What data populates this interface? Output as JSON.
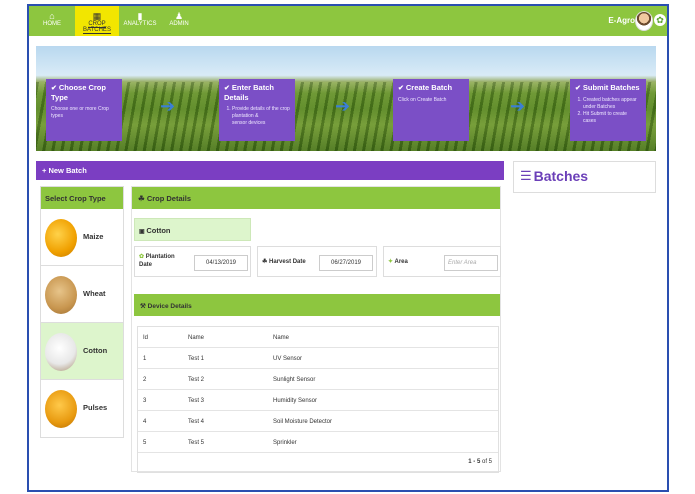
{
  "nav": {
    "items": [
      {
        "label": "HOME",
        "icon": "home-icon"
      },
      {
        "label": "CROP BATCHES",
        "icon": "grid-icon"
      },
      {
        "label": "ANALYTICS",
        "icon": "bar-chart-icon"
      },
      {
        "label": "ADMIN",
        "icon": "user-icon"
      }
    ],
    "active": "CROP BATCHES",
    "brand": "E-Agro"
  },
  "steps": [
    {
      "title": "Choose Crop Type",
      "desc": "Choose one or more Crop types"
    },
    {
      "title": "Enter Batch Details",
      "list": [
        "Provide details of the crop plantation &",
        "sensor devices"
      ]
    },
    {
      "title": "Create Batch",
      "desc": "Click on Create Batch"
    },
    {
      "title": "Submit Batches",
      "list": [
        "Created batches appear under Batches",
        "Hit Submit to create cases"
      ]
    }
  ],
  "new_batch_label": "+ New Batch",
  "batches_title": "Batches",
  "crop_type": {
    "title": "Select Crop Type",
    "crops": [
      {
        "name": "Maize"
      },
      {
        "name": "Wheat"
      },
      {
        "name": "Cotton"
      },
      {
        "name": "Pulses"
      }
    ],
    "selected": "Cotton"
  },
  "crop_details": {
    "title": "Crop Details",
    "selected_crop": "Cotton",
    "plantation_label": "Plantation Date",
    "plantation_date": "04/13/2019",
    "harvest_label": "Harvest Date",
    "harvest_date": "06/27/2019",
    "area_label": "Area",
    "area_placeholder": "Enter Area"
  },
  "device_details": {
    "title": "Device Details",
    "columns": [
      "Id",
      "Name",
      "Name"
    ],
    "rows": [
      [
        "1",
        "Test 1",
        "UV Sensor"
      ],
      [
        "2",
        "Test 2",
        "Sunlight Sensor"
      ],
      [
        "3",
        "Test 3",
        "Humidity Sensor"
      ],
      [
        "4",
        "Test 4",
        "Soil Moisture Detector"
      ],
      [
        "5",
        "Test 5",
        "Sprinkler"
      ]
    ],
    "pager_range": "1 - 5",
    "pager_total": " of 5"
  },
  "colors": {
    "accent_green": "#8dc63f",
    "accent_purple": "#7b3ec2",
    "active_nav": "#f2e600"
  }
}
